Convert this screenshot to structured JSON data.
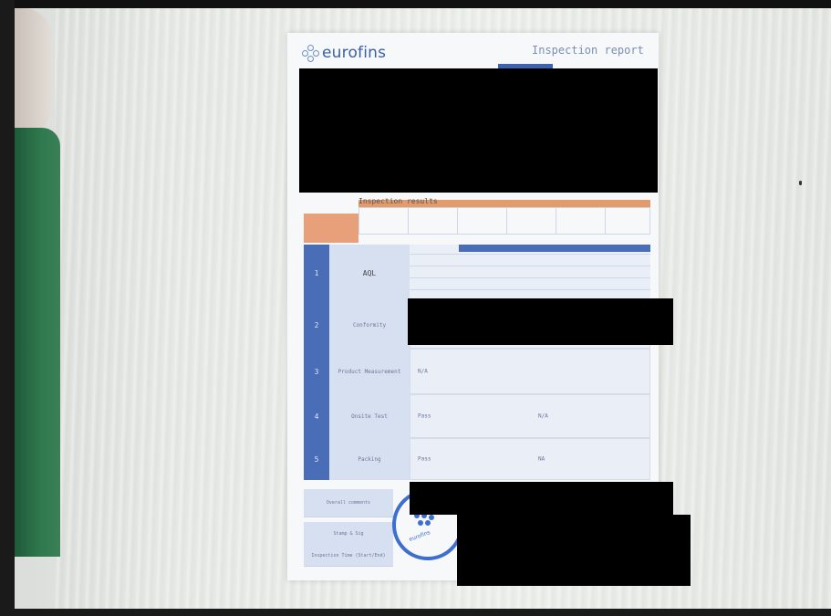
{
  "photo": {
    "subject": "inspection-report-sheet",
    "colors": {
      "accent_blue": "#4a6db8",
      "accent_orange": "#e59a6a",
      "stamp_blue": "#3d6fd0",
      "redaction": "#000000"
    }
  },
  "document": {
    "logo_text": "eurofins",
    "header_title": "Inspection report",
    "section_title": "Inspection results",
    "rows": [
      {
        "number": "1",
        "label": "AQL"
      },
      {
        "number": "2",
        "label": "Conformity"
      },
      {
        "number": "3",
        "label": "Product Measurement",
        "value": "N/A"
      },
      {
        "number": "4",
        "label": "Onsite Test",
        "value": "Pass",
        "value2": "N/A"
      },
      {
        "number": "5",
        "label": "Packing",
        "value": "Pass",
        "value2": "NA"
      }
    ],
    "bottom_labels": [
      "Overall comments",
      "Stamp & Sig",
      "Inspection Time (Start/End)"
    ],
    "stamp_text": "eurofins"
  }
}
